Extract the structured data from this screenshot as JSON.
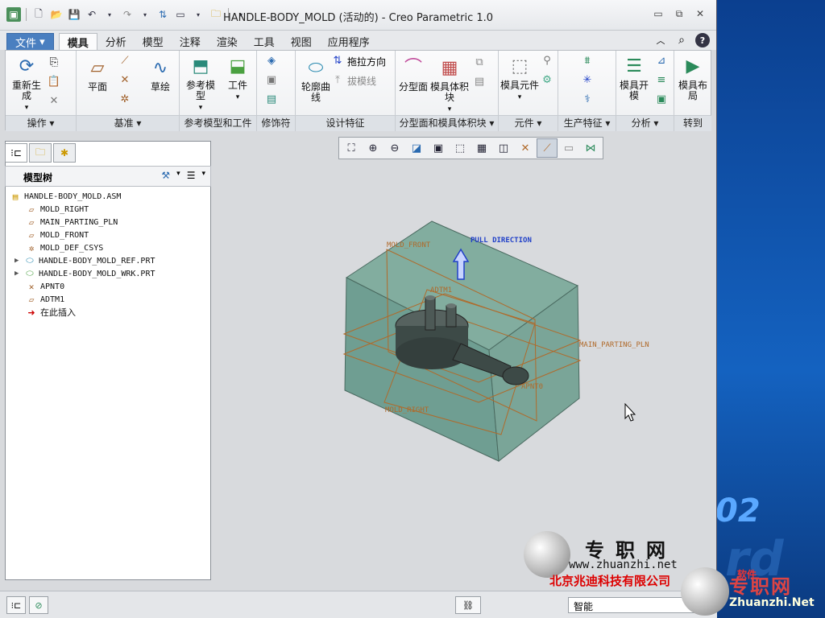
{
  "window": {
    "title": "HANDLE-BODY_MOLD (活动的) - Creo Parametric 1.0",
    "controls": [
      "minimize",
      "maximize",
      "close"
    ]
  },
  "quick_access": [
    "new",
    "open",
    "save",
    "undo",
    "redo",
    "regenerate",
    "windows",
    "open-folder",
    "customize"
  ],
  "tabs": [
    {
      "label": "文件",
      "type": "file"
    },
    {
      "label": "模具",
      "active": true
    },
    {
      "label": "分析"
    },
    {
      "label": "模型"
    },
    {
      "label": "注释"
    },
    {
      "label": "渲染"
    },
    {
      "label": "工具"
    },
    {
      "label": "视图"
    },
    {
      "label": "应用程序"
    }
  ],
  "ribbon": {
    "groups": [
      {
        "label": "操作",
        "buttons": [
          "重新生成"
        ]
      },
      {
        "label": "基准",
        "buttons": [
          "平面",
          "草绘"
        ]
      },
      {
        "label": "参考模型和工件",
        "buttons": [
          "参考模型",
          "工件"
        ]
      },
      {
        "label": "修饰符",
        "buttons": []
      },
      {
        "label": "设计特征",
        "buttons": [
          "轮廓曲线",
          "拖拉方向",
          "拔模线"
        ]
      },
      {
        "label": "分型面和模具体积块",
        "buttons": [
          "分型面",
          "模具体积块"
        ]
      },
      {
        "label": "元件",
        "buttons": [
          "模具元件"
        ]
      },
      {
        "label": "生产特征",
        "buttons": []
      },
      {
        "label": "分析",
        "buttons": [
          "模具开模"
        ]
      },
      {
        "label": "转到",
        "buttons": [
          "模具布局"
        ]
      }
    ],
    "btn": {
      "regen": "重新生成",
      "plane": "平面",
      "sketch": "草绘",
      "refmodel": "参考模型",
      "workpiece": "工件",
      "contour": "轮廓曲线",
      "pulldir": "拖拉方向",
      "draftline": "拔模线",
      "parting": "分型面",
      "volume": "模具体积块",
      "moldcomp": "模具元件",
      "open": "模具开模",
      "layout": "模具布局"
    }
  },
  "model_tree": {
    "title": "模型树",
    "items": [
      {
        "label": "HANDLE-BODY_MOLD.ASM",
        "icon": "assembly-icon"
      },
      {
        "label": "MOLD_RIGHT",
        "icon": "datum-plane-icon"
      },
      {
        "label": "MAIN_PARTING_PLN",
        "icon": "datum-plane-icon"
      },
      {
        "label": "MOLD_FRONT",
        "icon": "datum-plane-icon"
      },
      {
        "label": "MOLD_DEF_CSYS",
        "icon": "csys-icon"
      },
      {
        "label": "HANDLE-BODY_MOLD_REF.PRT",
        "icon": "part-icon",
        "expandable": true
      },
      {
        "label": "HANDLE-BODY_MOLD_WRK.PRT",
        "icon": "part-icon",
        "expandable": true
      },
      {
        "label": "APNT0",
        "icon": "datum-point-icon"
      },
      {
        "label": "ADTM1",
        "icon": "datum-plane-icon"
      },
      {
        "label": "在此插入",
        "icon": "insert-arrow-icon"
      }
    ]
  },
  "viewport_labels": {
    "mold_front": "MOLD_FRONT",
    "pull_direction": "PULL DIRECTION",
    "adtm1": "ADTM1",
    "main_parting": "MAIN_PARTING_PLN",
    "apnt0": "APNT0",
    "mold_right": "MOLD_RIGHT"
  },
  "status": {
    "filter": "智能"
  },
  "watermark": {
    "cn": "专职网",
    "url": "www.zhuanzhi.net",
    "company": "北京兆迪科技有限公司",
    "cn2": "专职网",
    "url2": "Zhuanzhi.Net",
    "tag": "软件"
  },
  "desktop": {
    "number": "02"
  },
  "colors": {
    "mold_box": "#6f9e92",
    "part": "#3d4a47",
    "datum": "#b06a2a",
    "pull_arrow": "#2040c8",
    "file_tab": "#4a7fc0"
  }
}
